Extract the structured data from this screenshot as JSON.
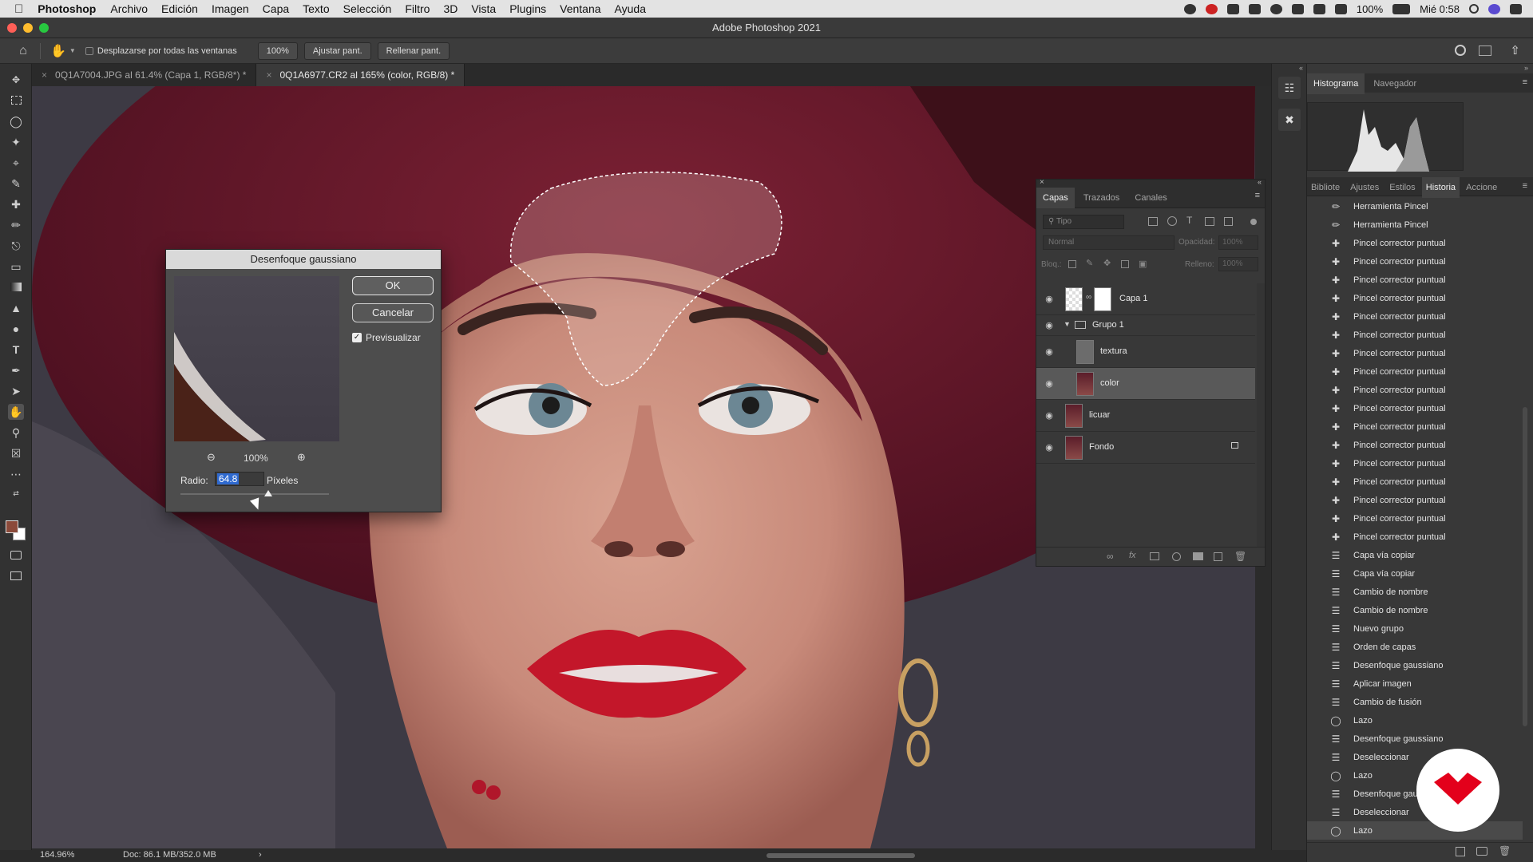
{
  "menubar": {
    "app": "Photoshop",
    "items": [
      "Archivo",
      "Edición",
      "Imagen",
      "Capa",
      "Texto",
      "Selección",
      "Filtro",
      "3D",
      "Vista",
      "Plugins",
      "Ventana",
      "Ayuda"
    ],
    "battery": "100%",
    "clock": "Mié 0:58"
  },
  "window": {
    "title": "Adobe Photoshop 2021"
  },
  "options": {
    "scroll_all_label": "Desplazarse por todas las ventanas",
    "zoom_100": "100%",
    "fit_screen": "Ajustar pant.",
    "fill_screen": "Rellenar pant."
  },
  "tabs": [
    {
      "label": "0Q1A7004.JPG al 61.4% (Capa 1, RGB/8*) *",
      "active": false
    },
    {
      "label": "0Q1A6977.CR2 al 165% (color, RGB/8) *",
      "active": true
    }
  ],
  "status": {
    "zoom": "164.96%",
    "doc": "Doc: 86.1 MB/352.0 MB"
  },
  "gaussian": {
    "title": "Desenfoque gaussiano",
    "ok": "OK",
    "cancel": "Cancelar",
    "preview_label": "Previsualizar",
    "preview_checked": true,
    "zoom": "100%",
    "radius_label": "Radio:",
    "radius_value": "64.8",
    "radius_unit": "Píxeles"
  },
  "layers": {
    "tabs": [
      "Capas",
      "Trazados",
      "Canales"
    ],
    "search_placeholder": "Tipo",
    "blend_mode": "Normal",
    "opacity_label": "Opacidad:",
    "opacity_value": "100%",
    "lock_label": "Bloq.:",
    "fill_label": "Relleno:",
    "fill_value": "100%",
    "items": [
      {
        "name": "Capa 1"
      },
      {
        "name": "Grupo 1"
      },
      {
        "name": "textura"
      },
      {
        "name": "color"
      },
      {
        "name": "licuar"
      },
      {
        "name": "Fondo"
      }
    ]
  },
  "histogram_panel": {
    "tabs": [
      "Histograma",
      "Navegador"
    ]
  },
  "history_panel": {
    "tabs": [
      "Bibliote",
      "Ajustes",
      "Estilos",
      "Historia",
      "Accione"
    ],
    "items": [
      {
        "label": "Herramienta Pincel",
        "icon": "brush-icon"
      },
      {
        "label": "Herramienta Pincel",
        "icon": "brush-icon"
      },
      {
        "label": "Pincel corrector puntual",
        "icon": "healing-brush-icon"
      },
      {
        "label": "Pincel corrector puntual",
        "icon": "healing-brush-icon"
      },
      {
        "label": "Pincel corrector puntual",
        "icon": "healing-brush-icon"
      },
      {
        "label": "Pincel corrector puntual",
        "icon": "healing-brush-icon"
      },
      {
        "label": "Pincel corrector puntual",
        "icon": "healing-brush-icon"
      },
      {
        "label": "Pincel corrector puntual",
        "icon": "healing-brush-icon"
      },
      {
        "label": "Pincel corrector puntual",
        "icon": "healing-brush-icon"
      },
      {
        "label": "Pincel corrector puntual",
        "icon": "healing-brush-icon"
      },
      {
        "label": "Pincel corrector puntual",
        "icon": "healing-brush-icon"
      },
      {
        "label": "Pincel corrector puntual",
        "icon": "healing-brush-icon"
      },
      {
        "label": "Pincel corrector puntual",
        "icon": "healing-brush-icon"
      },
      {
        "label": "Pincel corrector puntual",
        "icon": "healing-brush-icon"
      },
      {
        "label": "Pincel corrector puntual",
        "icon": "healing-brush-icon"
      },
      {
        "label": "Pincel corrector puntual",
        "icon": "healing-brush-icon"
      },
      {
        "label": "Pincel corrector puntual",
        "icon": "healing-brush-icon"
      },
      {
        "label": "Pincel corrector puntual",
        "icon": "healing-brush-icon"
      },
      {
        "label": "Pincel corrector puntual",
        "icon": "healing-brush-icon"
      },
      {
        "label": "Capa vía copiar",
        "icon": "document-icon"
      },
      {
        "label": "Capa vía copiar",
        "icon": "document-icon"
      },
      {
        "label": "Cambio de nombre",
        "icon": "document-icon"
      },
      {
        "label": "Cambio de nombre",
        "icon": "document-icon"
      },
      {
        "label": "Nuevo grupo",
        "icon": "document-icon"
      },
      {
        "label": "Orden de capas",
        "icon": "document-icon"
      },
      {
        "label": "Desenfoque gaussiano",
        "icon": "document-icon"
      },
      {
        "label": "Aplicar imagen",
        "icon": "document-icon"
      },
      {
        "label": "Cambio de fusión",
        "icon": "document-icon"
      },
      {
        "label": "Lazo",
        "icon": "lasso-icon"
      },
      {
        "label": "Desenfoque gaussiano",
        "icon": "document-icon"
      },
      {
        "label": "Deseleccionar",
        "icon": "document-icon"
      },
      {
        "label": "Lazo",
        "icon": "lasso-icon"
      },
      {
        "label": "Desenfoque gauss",
        "icon": "document-icon"
      },
      {
        "label": "Deseleccionar",
        "icon": "document-icon"
      },
      {
        "label": "Lazo",
        "icon": "lasso-icon"
      }
    ]
  },
  "colors": {
    "brand_logo": "#e3001b",
    "selection": "#595959"
  }
}
